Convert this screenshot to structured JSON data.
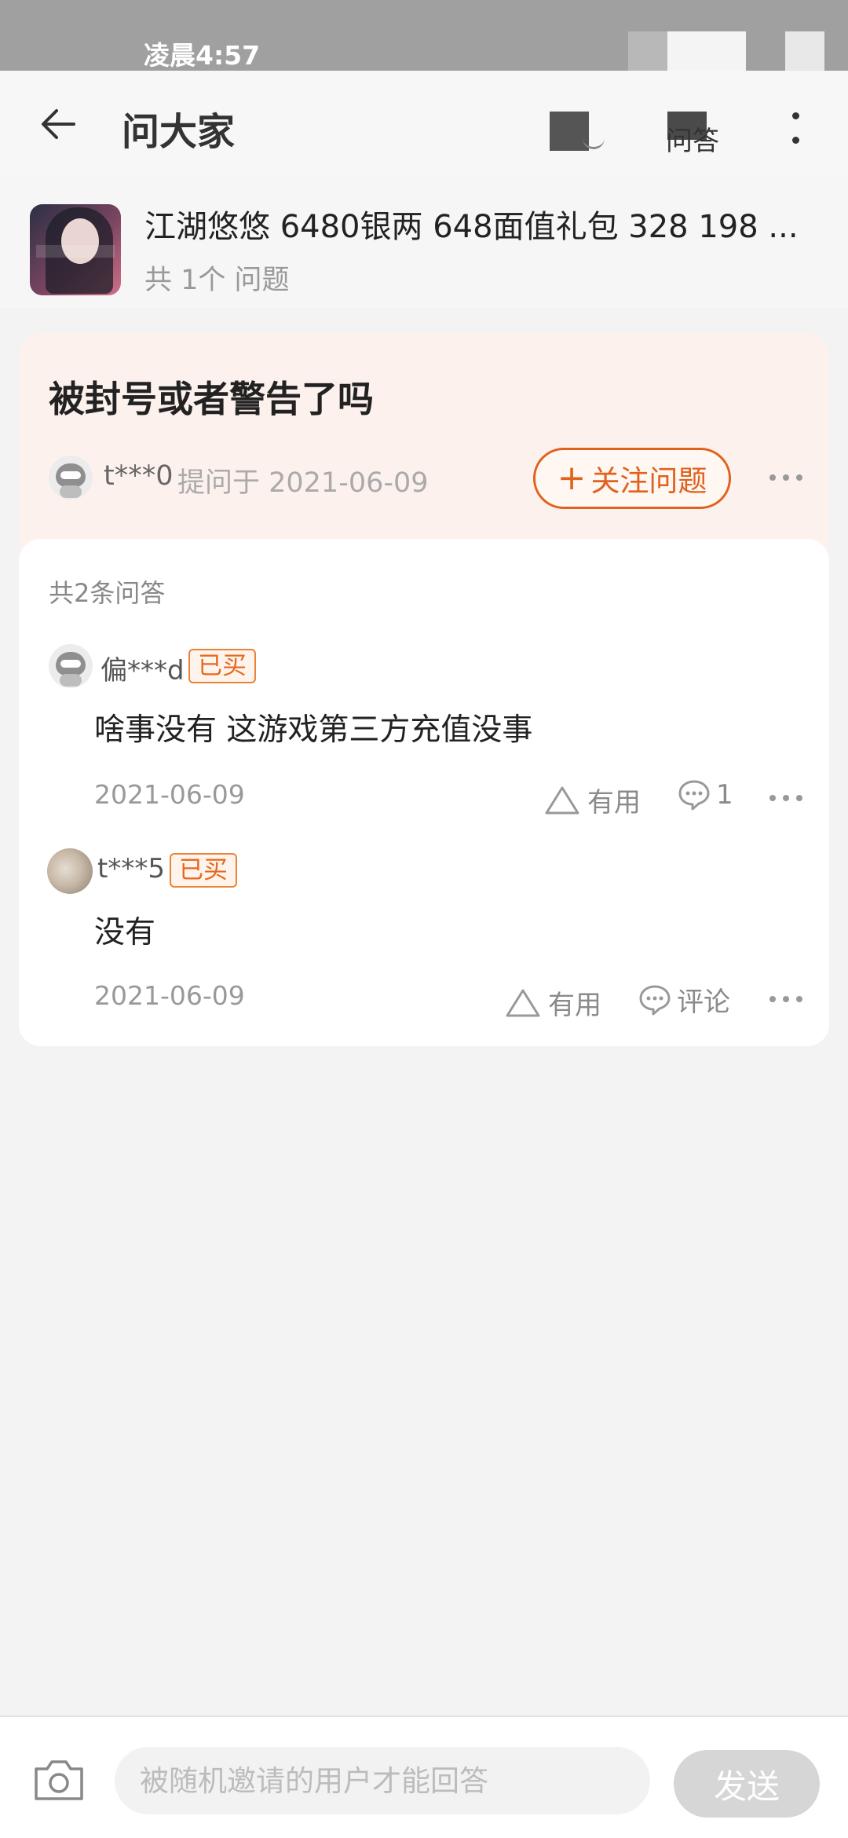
{
  "status_bar": {
    "time": "凌晨4:57"
  },
  "header": {
    "title": "问大家",
    "qa_label": "问答",
    "icons": [
      "back-arrow-icon",
      "share-icon",
      "qa-icon",
      "more-vertical-icon"
    ]
  },
  "product": {
    "title": "江湖悠悠 6480银两 648面值礼包 328 198 ...",
    "question_count": "共 1个 问题"
  },
  "question": {
    "title": "被封号或者警告了吗",
    "asker": "t***0",
    "asked_at": "提问于 2021-06-09",
    "follow_label": "关注问题"
  },
  "answers": {
    "count_label": "共2条问答",
    "items": [
      {
        "user": "偏***d",
        "badge": "已买",
        "text": "啥事没有 这游戏第三方充值没事",
        "date": "2021-06-09",
        "useful_label": "有用",
        "comment_label": "1"
      },
      {
        "user": "t***5",
        "badge": "已买",
        "text": "没有",
        "date": "2021-06-09",
        "useful_label": "有用",
        "comment_label": "评论"
      }
    ]
  },
  "bottom": {
    "input_placeholder": "被随机邀请的用户才能回答",
    "send_label": "发送"
  },
  "colors": {
    "accent": "#e0621e",
    "question_bg": "#fdf1ee",
    "page_bg": "#f3f3f3"
  }
}
